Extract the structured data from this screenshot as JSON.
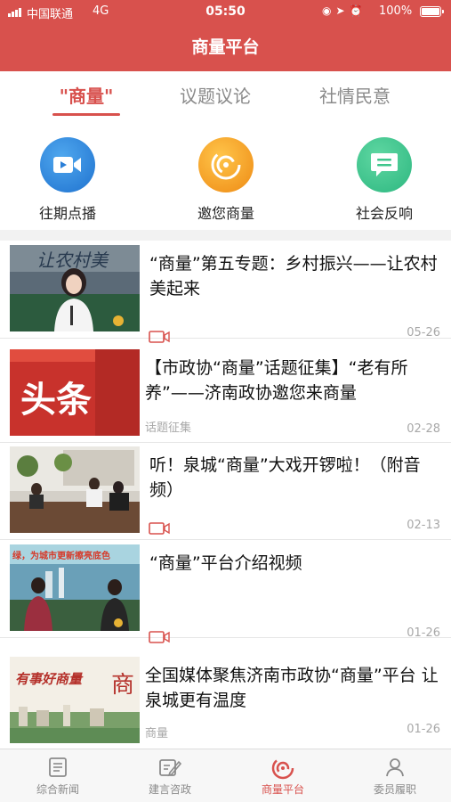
{
  "status_bar": {
    "carrier": "中国联通",
    "network": "4G",
    "time": "05:50",
    "battery": "100%"
  },
  "header": {
    "title": "商量平台"
  },
  "tabs": [
    {
      "label": "\"商量\"",
      "active": true
    },
    {
      "label": "议题议论",
      "active": false
    },
    {
      "label": "社情民意",
      "active": false
    }
  ],
  "quick_actions": [
    {
      "label": "往期点播",
      "icon": "video-camera-icon",
      "color": "#2f86de"
    },
    {
      "label": "邀您商量",
      "icon": "swirl-logo-icon",
      "color": "#f3a228"
    },
    {
      "label": "社会反响",
      "icon": "message-icon",
      "color": "#3fc68c"
    }
  ],
  "news": [
    {
      "title": "“商量”第五专题：乡村振兴——让农村美起来",
      "tag": "",
      "has_video": true,
      "date": "05-26",
      "thumb_text": "让农村美"
    },
    {
      "title": "【市政协“商量”话题征集】“老有所养”——济南政协邀您来商量",
      "tag": "话题征集",
      "has_video": false,
      "date": "02-28",
      "thumb_text": "头条"
    },
    {
      "title": "听！泉城“商量”大戏开锣啦！（附音频）",
      "tag": "",
      "has_video": true,
      "date": "02-13",
      "thumb_text": ""
    },
    {
      "title": "“商量”平台介绍视频",
      "tag": "",
      "has_video": true,
      "date": "01-26",
      "thumb_text": "绿，为城市更新擦亮底色"
    },
    {
      "title": "全国媒体聚焦济南市政协“商量”平台 让泉城更有温度",
      "tag": "商量",
      "has_video": false,
      "date": "01-26",
      "thumb_text": "有事好商量"
    }
  ],
  "bottom_nav": [
    {
      "label": "综合新闻",
      "icon": "newspaper-icon",
      "active": false
    },
    {
      "label": "建言咨政",
      "icon": "pen-note-icon",
      "active": false
    },
    {
      "label": "商量平台",
      "icon": "swirl-logo-icon",
      "active": true
    },
    {
      "label": "委员履职",
      "icon": "person-icon",
      "active": false
    }
  ],
  "colors": {
    "brand": "#d8514d",
    "muted": "#a8a8a8"
  }
}
